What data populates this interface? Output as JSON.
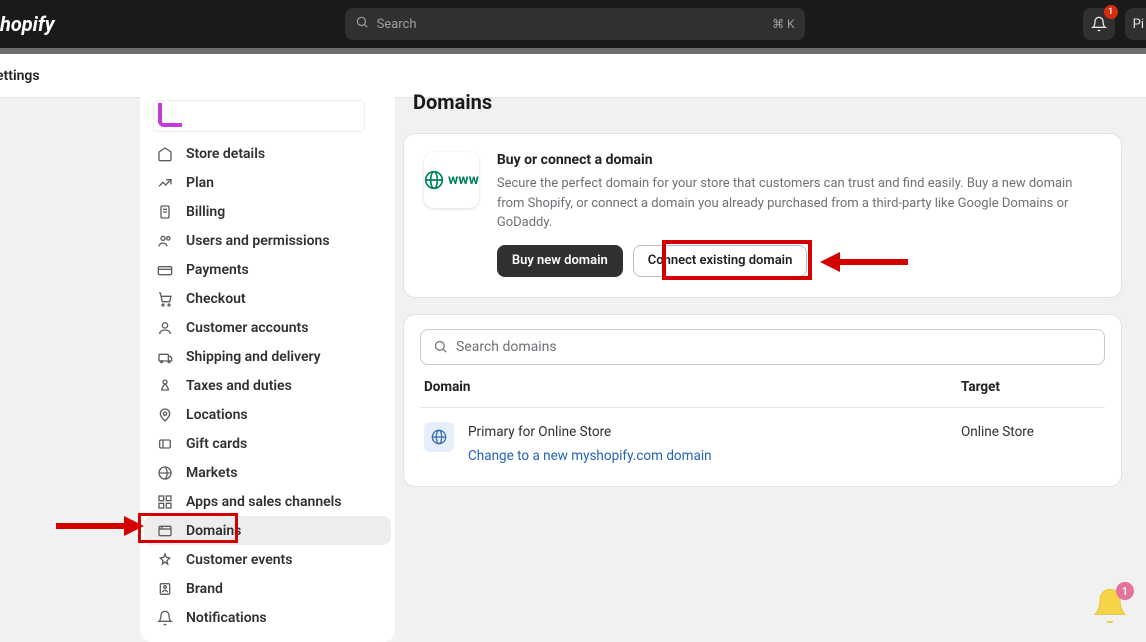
{
  "topbar": {
    "logo_text": "shopify",
    "search_placeholder": "Search",
    "search_kbd": "⌘ K",
    "bell_count": "1",
    "account_abbrev": "Pi"
  },
  "section_label": "ettings",
  "sidebar": {
    "items": [
      {
        "label": "Store details"
      },
      {
        "label": "Plan"
      },
      {
        "label": "Billing"
      },
      {
        "label": "Users and permissions"
      },
      {
        "label": "Payments"
      },
      {
        "label": "Checkout"
      },
      {
        "label": "Customer accounts"
      },
      {
        "label": "Shipping and delivery"
      },
      {
        "label": "Taxes and duties"
      },
      {
        "label": "Locations"
      },
      {
        "label": "Gift cards"
      },
      {
        "label": "Markets"
      },
      {
        "label": "Apps and sales channels"
      },
      {
        "label": "Domains"
      },
      {
        "label": "Customer events"
      },
      {
        "label": "Brand"
      },
      {
        "label": "Notifications"
      }
    ],
    "active_index": 13
  },
  "page": {
    "title": "Domains",
    "intro": {
      "icon_text": "www",
      "heading": "Buy or connect a domain",
      "description": "Secure the perfect domain for your store that customers can trust and find easily. Buy a new domain from Shopify, or connect a domain you already purchased from a third-party like Google Domains or GoDaddy.",
      "buy_btn": "Buy new domain",
      "connect_btn": "Connect existing domain"
    },
    "domain_search_placeholder": "Search domains",
    "table": {
      "col_domain": "Domain",
      "col_target": "Target"
    },
    "row": {
      "primary_label": "Primary for Online Store",
      "change_link": "Change to a new myshopify.com domain",
      "target": "Online Store"
    }
  },
  "floating_bell_count": "1"
}
